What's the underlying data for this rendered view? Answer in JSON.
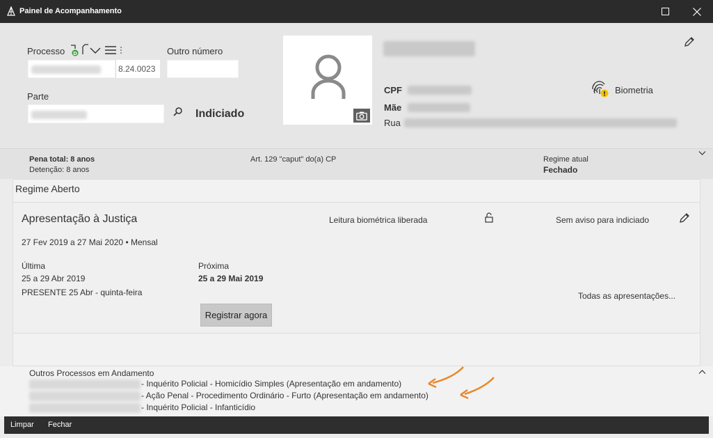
{
  "window": {
    "title": "Painel de Acompanhamento"
  },
  "header": {
    "processo_label": "Processo",
    "processo_suffix": "8.24.0023",
    "outro_numero_label": "Outro número",
    "parte_label": "Parte",
    "indiciado": "Indiciado",
    "cpf_label": "CPF",
    "mae_label": "Mãe",
    "rua_label": "Rua",
    "biometria_label": "Biometria"
  },
  "pena": {
    "total": "Pena total: 8 anos",
    "detencao": "Detenção: 8 anos",
    "artigo": "Art. 129 \"caput\" do(a) CP",
    "regime_label": "Regime atual",
    "regime_value": "Fechado"
  },
  "regime": {
    "title": "Regime Aberto",
    "card": {
      "title": "Apresentação à Justiça",
      "leitura": "Leitura biométrica liberada",
      "aviso": "Sem aviso para indiciado",
      "periodo": "27 Fev 2019 a 27 Mai 2020 • Mensal",
      "ultima_label": "Última",
      "ultima_periodo": "25 a 29 Abr 2019",
      "ultima_status": "PRESENTE 25 Abr - quinta-feira",
      "proxima_label": "Próxima",
      "proxima_periodo": "25 a 29 Mai 2019",
      "todas_link": "Todas as apresentações...",
      "registrar_button": "Registrar agora"
    }
  },
  "outros": {
    "title": "Outros Processos em Andamento",
    "items": [
      "- Inquérito Policial - Homicídio Simples  (Apresentação em andamento)",
      "- Ação Penal - Procedimento Ordinário - Furto  (Apresentação em andamento)",
      "- Inquérito Policial - Infanticídio"
    ]
  },
  "footer": {
    "limpar": "Limpar",
    "fechar": "Fechar"
  },
  "colors": {
    "titlebar": "#2b2b2b",
    "warning": "#f5c000",
    "arrow": "#e8872a",
    "badge_green": "#2ca02c"
  }
}
